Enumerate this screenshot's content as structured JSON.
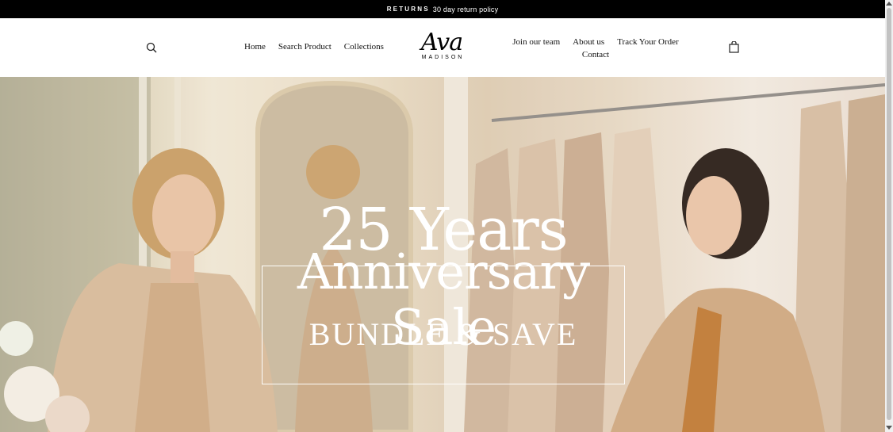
{
  "announcement": {
    "bold": "RETURNS",
    "text": "30 day return policy"
  },
  "header": {
    "search_icon": "search-icon",
    "nav_left": [
      "Home",
      "Search Product",
      "Collections"
    ],
    "logo": {
      "script": "Ava",
      "sub": "MADISON"
    },
    "nav_right_row1": [
      "Join our team",
      "About us",
      "Track Your Order"
    ],
    "nav_right_row2": [
      "Contact"
    ],
    "cart_icon": "shopping-bag-icon"
  },
  "hero": {
    "line1": "25 Years",
    "line2": "Anniversary Sale",
    "line3": "BUNDLE & SAVE"
  },
  "colors": {
    "announcement_bg": "#000000",
    "hero_text": "#ffffff",
    "coat": "#d7b998"
  }
}
